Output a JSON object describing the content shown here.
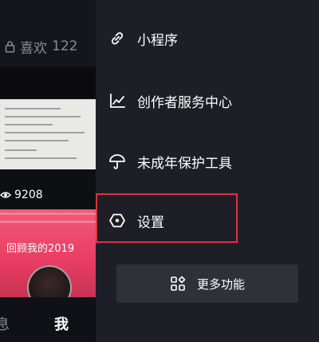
{
  "profile": {
    "likes_label": "喜欢",
    "likes_count": "122",
    "view_count": "9208",
    "video_title": "回顾我的2019"
  },
  "bottom_nav": {
    "messages_label": "息",
    "me_label": "我"
  },
  "drawer": {
    "items": [
      {
        "label": "小程序",
        "icon": "mini-program-icon"
      },
      {
        "label": "创作者服务中心",
        "icon": "chart-line-icon"
      },
      {
        "label": "未成年保护工具",
        "icon": "umbrella-icon"
      },
      {
        "label": "设置",
        "icon": "settings-hexagon-icon"
      }
    ],
    "more_button_label": "更多功能",
    "more_button_icon": "grid-icon",
    "highlight_color": "#e0313c"
  }
}
